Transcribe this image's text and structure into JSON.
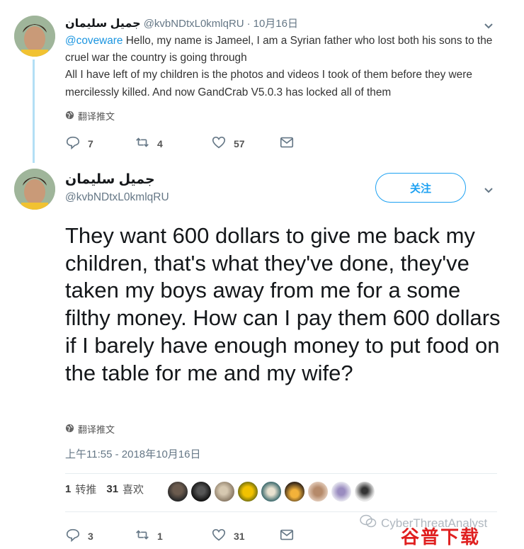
{
  "reply_tweet": {
    "name": "جميل سليمان",
    "handle": "@kvbNDtxL0kmlqRU",
    "separator": "·",
    "date": "10月16日",
    "mention": "@coveware",
    "text": " Hello, my name is Jameel, I am a Syrian father who lost both his sons to the cruel war the country is going through\nAll I have left of my children is the photos and videos I took of them before they were mercilessly killed. And now GandCrab V5.0.3 has locked all of them",
    "translate_label": "翻译推文",
    "reply_count": "7",
    "retweet_count": "4",
    "like_count": "57"
  },
  "main_tweet": {
    "name": "جميل سليمان",
    "handle": "@kvbNDtxL0kmlqRU",
    "follow_label": "关注",
    "text": "They want 600 dollars to give me back my children, that's what they've done, they've taken my boys away from me for a some filthy money. How can I pay them 600 dollars if I barely have enough money to put food on the table for me and my wife?",
    "translate_label": "翻译推文",
    "timestamp": "上午11:55 - 2018年10月16日",
    "retweets_num": "1",
    "retweets_label": "转推",
    "likes_num": "31",
    "likes_label": "喜欢",
    "reply_count": "3",
    "retweet_count": "1",
    "like_count": "31"
  },
  "watermark": {
    "line1": "CyberThreatAnalyst",
    "line2": "谷普下载"
  },
  "colors": {
    "accent": "#1da1f2",
    "thread_line": "#b3dff5",
    "secondary_text": "#657786"
  },
  "icons": [
    "reply-icon",
    "retweet-icon",
    "like-icon",
    "dm-icon",
    "globe-icon",
    "chevron-down-icon"
  ]
}
